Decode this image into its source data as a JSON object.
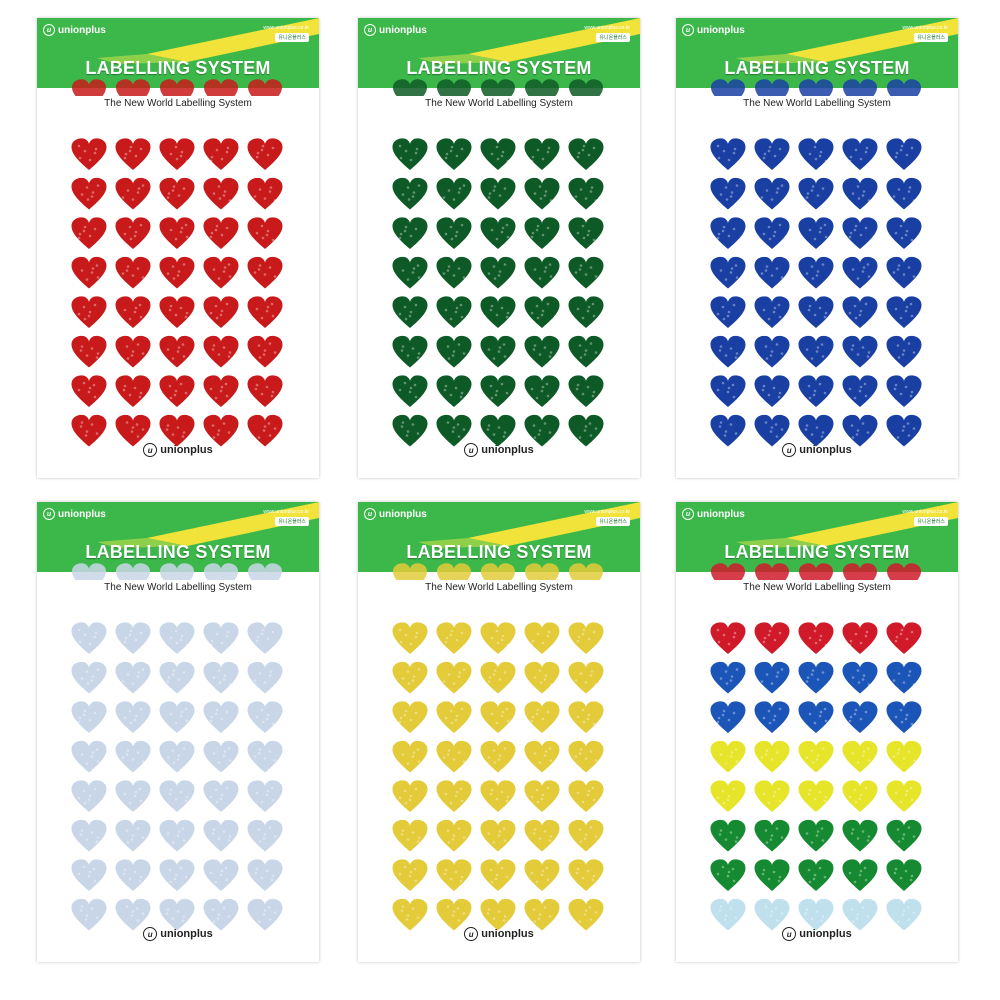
{
  "header": {
    "brand": "unionplus",
    "url": "www.unionplus.co.kr",
    "tag": "유니온플러스",
    "title": "LABELLING SYSTEM"
  },
  "subtitle": "The New World Labelling System",
  "footer_brand": "unionplus",
  "sheets": [
    {
      "id": "red",
      "rows": [
        "#c81a1a",
        "#c81a1a",
        "#c81a1a",
        "#c81a1a",
        "#c81a1a",
        "#c81a1a",
        "#c81a1a",
        "#c81a1a"
      ],
      "partial_top": "#c81a1a"
    },
    {
      "id": "green",
      "rows": [
        "#0e5a26",
        "#0e5a26",
        "#0e5a26",
        "#0e5a26",
        "#0e5a26",
        "#0e5a26",
        "#0e5a26",
        "#0e5a26"
      ],
      "partial_top": "#0e5a26"
    },
    {
      "id": "blue",
      "rows": [
        "#1a3fa3",
        "#1a3fa3",
        "#1a3fa3",
        "#1a3fa3",
        "#1a3fa3",
        "#1a3fa3",
        "#1a3fa3",
        "#1a3fa3"
      ],
      "partial_top": "#1a3fa3"
    },
    {
      "id": "silver",
      "rows": [
        "#c9d6e8",
        "#c9d6e8",
        "#c9d6e8",
        "#c9d6e8",
        "#c9d6e8",
        "#c9d6e8",
        "#c9d6e8",
        "#c9d6e8"
      ],
      "partial_top": "#c9d6e8"
    },
    {
      "id": "gold",
      "rows": [
        "#e3cb3a",
        "#e3cb3a",
        "#e3cb3a",
        "#e3cb3a",
        "#e3cb3a",
        "#e3cb3a",
        "#e3cb3a",
        "#e3cb3a"
      ],
      "partial_top": "#e3cb3a"
    },
    {
      "id": "mixed",
      "rows": [
        "#d01a2a",
        "#1c55b8",
        "#1c55b8",
        "#e6e52a",
        "#e6e52a",
        "#168a32",
        "#168a32",
        "#bfe0ec"
      ],
      "partial_top": "#d01a2a"
    }
  ],
  "colors": {
    "header_green": "#3cb84a",
    "header_yellow": "#f2e33a"
  }
}
